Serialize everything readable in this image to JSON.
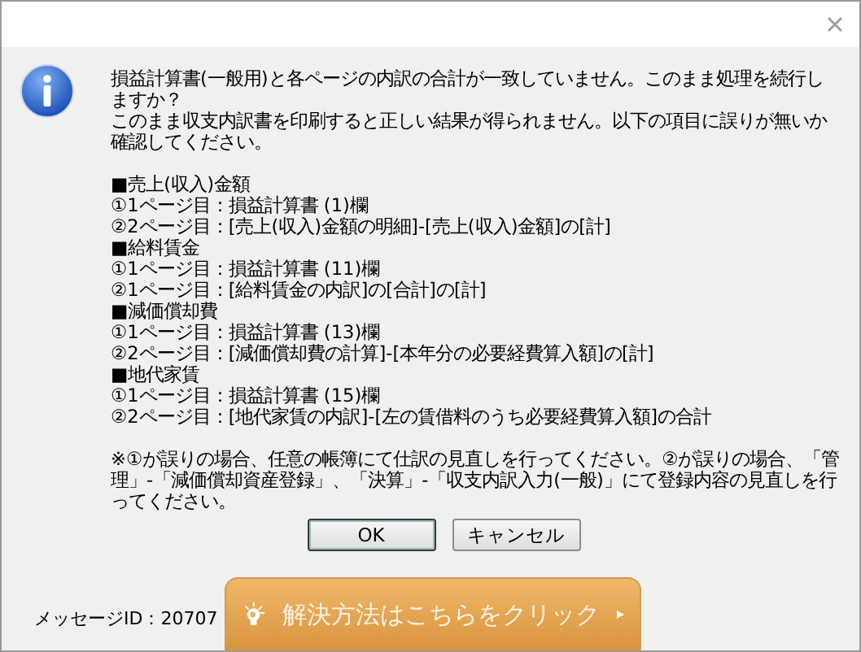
{
  "dialog": {
    "intro": [
      "損益計算書(一般用)と各ページの内訳の合計が一致していません。このまま処理を続行しますか？",
      "このまま収支内訳書を印刷すると正しい結果が得られません。以下の項目に誤りが無いか確認してください。"
    ],
    "sections": [
      {
        "heading": "■売上(収入)金額",
        "items": [
          "①1ページ目：損益計算書 (1)欄",
          "②2ページ目：[売上(収入)金額の明細]-[売上(収入)金額]の[計]"
        ]
      },
      {
        "heading": "■給料賃金",
        "items": [
          "①1ページ目：損益計算書 (11)欄",
          "②1ページ目：[給料賃金の内訳]の[合計]の[計]"
        ]
      },
      {
        "heading": "■減価償却費",
        "items": [
          "①1ページ目：損益計算書 (13)欄",
          "②2ページ目：[減価償却費の計算]-[本年分の必要経費算入額]の[計]"
        ]
      },
      {
        "heading": "■地代家賃",
        "items": [
          "①1ページ目：損益計算書 (15)欄",
          "②2ページ目：[地代家賃の内訳]-[左の賃借料のうち必要経費算入額]の合計"
        ]
      }
    ],
    "note": "※①が誤りの場合、任意の帳簿にて仕訳の見直しを行ってください。②が誤りの場合、「管理」-「減価償却資産登録」、「決算」-「収支内訳入力(一般)」にて登録内容の見直しを行ってください。",
    "buttons": [
      {
        "label": "OK",
        "selected": true
      },
      {
        "label": "キャンセル",
        "selected": false
      }
    ],
    "message_id": "メッセージID：20707",
    "help_button": "解決方法はこちらをクリック"
  }
}
